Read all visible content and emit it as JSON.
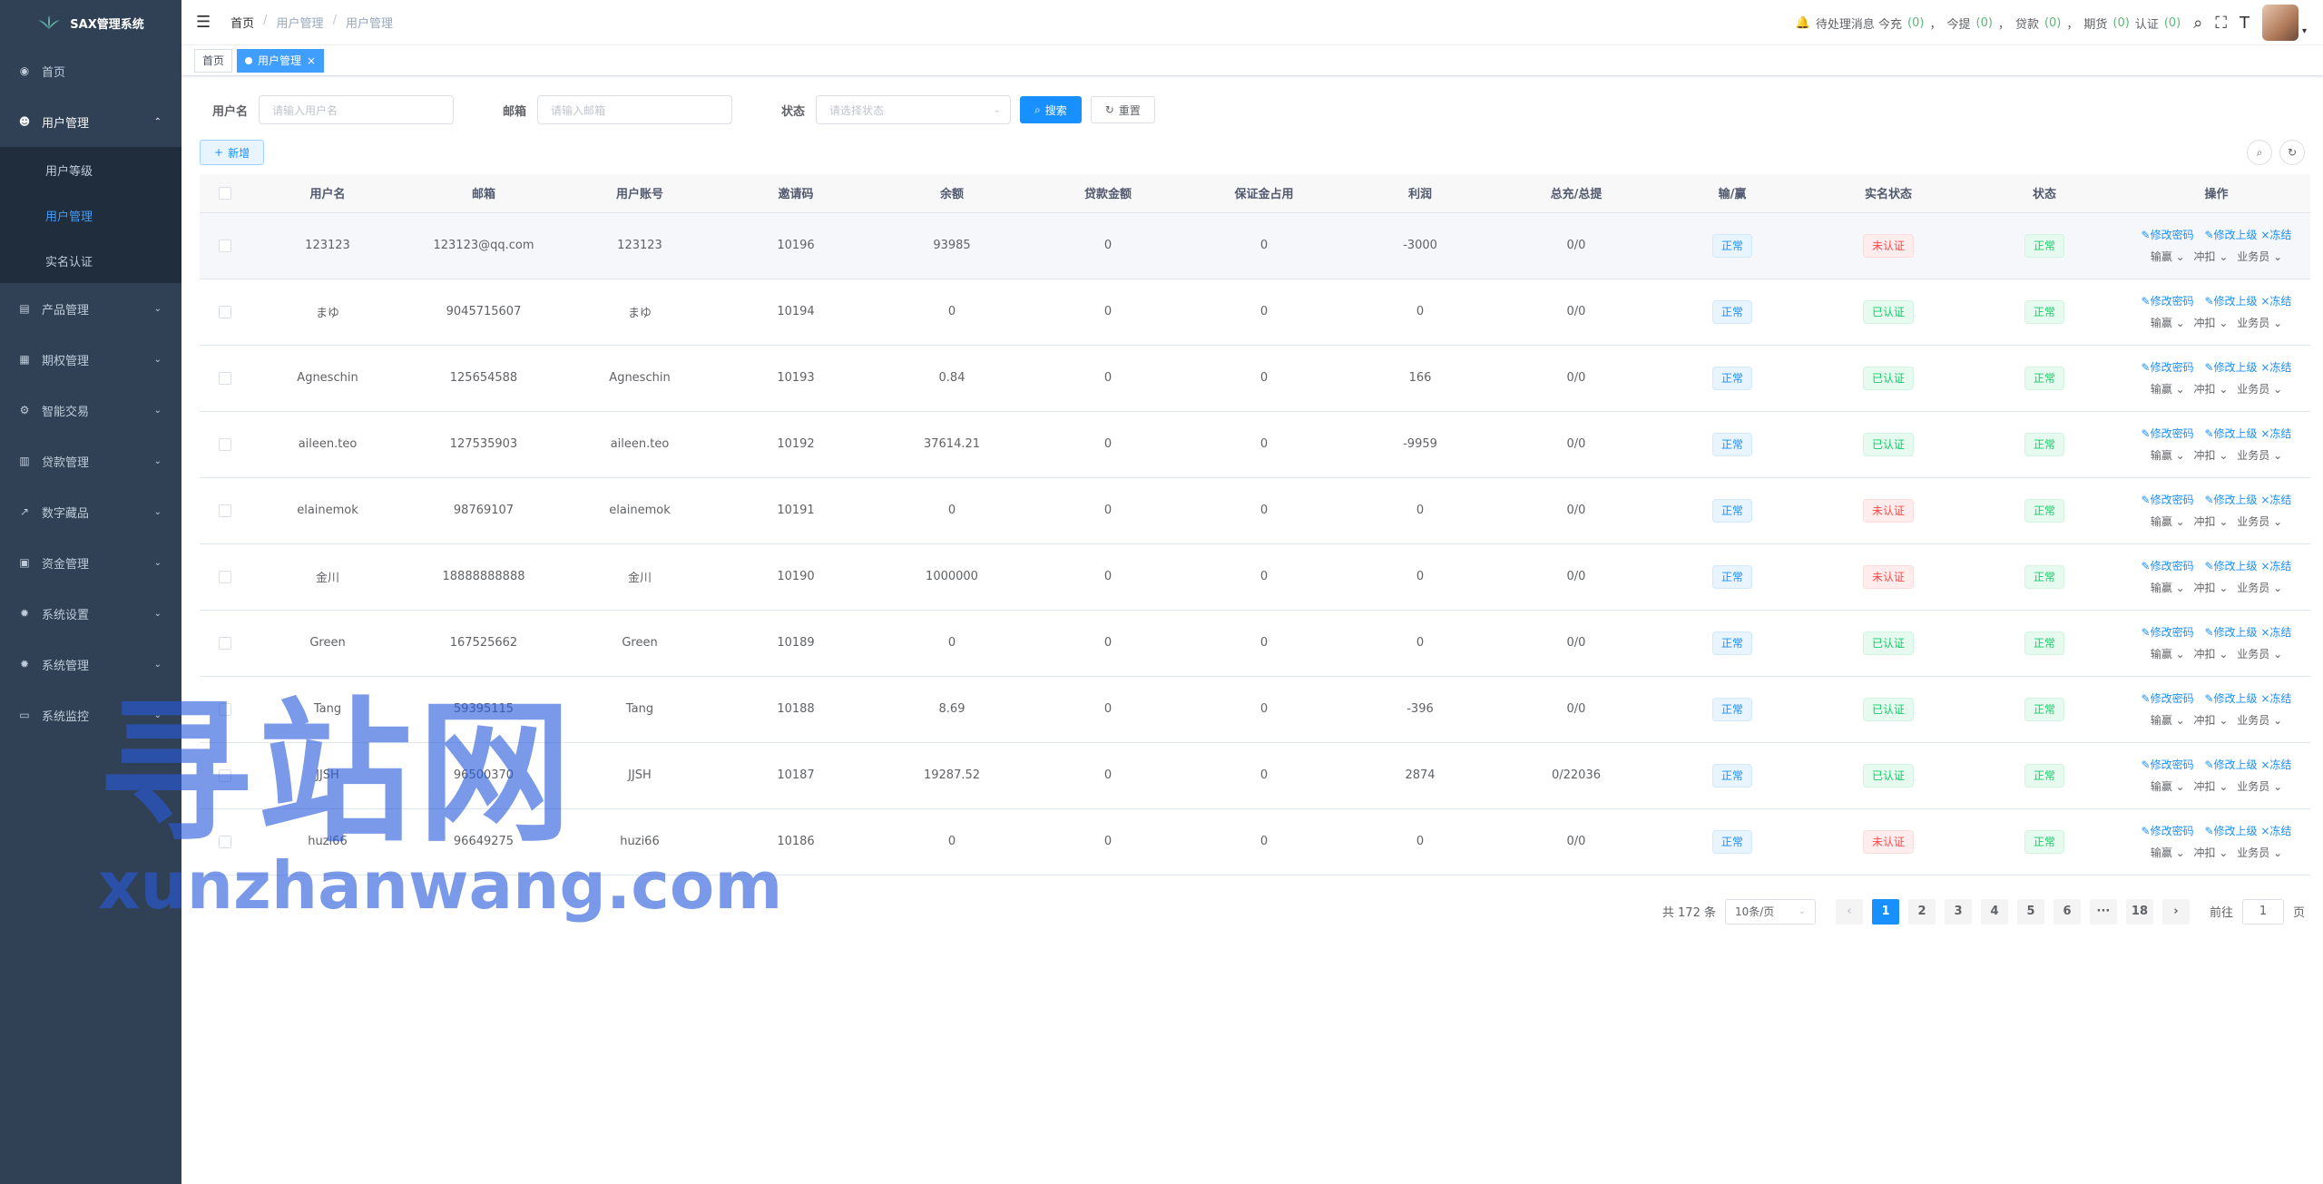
{
  "app": {
    "title": "SAX管理系统"
  },
  "sidebar": {
    "items": [
      {
        "label": "首页",
        "icon": "dashboard-icon",
        "has_arrow": false
      },
      {
        "label": "用户管理",
        "icon": "user-icon",
        "has_arrow": true,
        "open": true,
        "children": [
          {
            "label": "用户等级",
            "active": false
          },
          {
            "label": "用户管理",
            "active": true
          },
          {
            "label": "实名认证",
            "active": false
          }
        ]
      },
      {
        "label": "产品管理",
        "icon": "document-icon",
        "has_arrow": true
      },
      {
        "label": "期权管理",
        "icon": "chart-icon",
        "has_arrow": true
      },
      {
        "label": "智能交易",
        "icon": "gear-icon",
        "has_arrow": true
      },
      {
        "label": "贷款管理",
        "icon": "server-icon",
        "has_arrow": true
      },
      {
        "label": "数字藏品",
        "icon": "trend-icon",
        "has_arrow": true
      },
      {
        "label": "资金管理",
        "icon": "wallet-icon",
        "has_arrow": true
      },
      {
        "label": "系统设置",
        "icon": "settings-icon",
        "has_arrow": true
      },
      {
        "label": "系统管理",
        "icon": "settings-icon",
        "has_arrow": true
      },
      {
        "label": "系统监控",
        "icon": "monitor-icon",
        "has_arrow": true
      }
    ]
  },
  "navbar": {
    "breadcrumb": [
      "首页",
      "用户管理",
      "用户管理"
    ],
    "notice_prefix": "待处理消息 今充",
    "counters": [
      {
        "label": "",
        "value": "(0)"
      },
      {
        "label": "今提",
        "value": "(0)"
      },
      {
        "label": "贷款",
        "value": "(0)"
      },
      {
        "label": "期货",
        "value": "(0)"
      },
      {
        "label": "认证",
        "value": "(0)"
      }
    ]
  },
  "tags": {
    "home": "首页",
    "active": "用户管理",
    "close": "×"
  },
  "search": {
    "username_label": "用户名",
    "username_placeholder": "请输入用户名",
    "email_label": "邮箱",
    "email_placeholder": "请输入邮箱",
    "status_label": "状态",
    "status_placeholder": "请选择状态",
    "search_btn": "搜索",
    "reset_btn": "重置"
  },
  "toolbar": {
    "add_btn": "新增"
  },
  "table": {
    "headers": [
      "用户名",
      "邮箱",
      "用户账号",
      "邀请码",
      "余额",
      "贷款金额",
      "保证金占用",
      "利润",
      "总充/总提",
      "输/赢",
      "实名状态",
      "状态",
      "操作"
    ],
    "rows": [
      {
        "username": "123123",
        "email": "123123@qq.com",
        "account": "123123",
        "invite": "10196",
        "balance": "93985",
        "loan": "0",
        "margin": "0",
        "profit": "-3000",
        "charge": "0/0",
        "win": "正常",
        "verify": "未认证",
        "verified": false,
        "status": "正常"
      },
      {
        "username": "まゆ",
        "email": "9045715607",
        "account": "まゆ",
        "invite": "10194",
        "balance": "0",
        "loan": "0",
        "margin": "0",
        "profit": "0",
        "charge": "0/0",
        "win": "正常",
        "verify": "已认证",
        "verified": true,
        "status": "正常"
      },
      {
        "username": "Agneschin",
        "email": "125654588",
        "account": "Agneschin",
        "invite": "10193",
        "balance": "0.84",
        "loan": "0",
        "margin": "0",
        "profit": "166",
        "charge": "0/0",
        "win": "正常",
        "verify": "已认证",
        "verified": true,
        "status": "正常"
      },
      {
        "username": "aileen.teo",
        "email": "127535903",
        "account": "aileen.teo",
        "invite": "10192",
        "balance": "37614.21",
        "loan": "0",
        "margin": "0",
        "profit": "-9959",
        "charge": "0/0",
        "win": "正常",
        "verify": "已认证",
        "verified": true,
        "status": "正常"
      },
      {
        "username": "elainemok",
        "email": "98769107",
        "account": "elainemok",
        "invite": "10191",
        "balance": "0",
        "loan": "0",
        "margin": "0",
        "profit": "0",
        "charge": "0/0",
        "win": "正常",
        "verify": "未认证",
        "verified": false,
        "status": "正常"
      },
      {
        "username": "金川",
        "email": "18888888888",
        "account": "金川",
        "invite": "10190",
        "balance": "1000000",
        "loan": "0",
        "margin": "0",
        "profit": "0",
        "charge": "0/0",
        "win": "正常",
        "verify": "未认证",
        "verified": false,
        "status": "正常"
      },
      {
        "username": "Green",
        "email": "167525662",
        "account": "Green",
        "invite": "10189",
        "balance": "0",
        "loan": "0",
        "margin": "0",
        "profit": "0",
        "charge": "0/0",
        "win": "正常",
        "verify": "已认证",
        "verified": true,
        "status": "正常"
      },
      {
        "username": "Tang",
        "email": "59395115",
        "account": "Tang",
        "invite": "10188",
        "balance": "8.69",
        "loan": "0",
        "margin": "0",
        "profit": "-396",
        "charge": "0/0",
        "win": "正常",
        "verify": "已认证",
        "verified": true,
        "status": "正常"
      },
      {
        "username": "JJSH",
        "email": "96500370",
        "account": "JJSH",
        "invite": "10187",
        "balance": "19287.52",
        "loan": "0",
        "margin": "0",
        "profit": "2874",
        "charge": "0/22036",
        "win": "正常",
        "verify": "已认证",
        "verified": true,
        "status": "正常"
      },
      {
        "username": "huzi66",
        "email": "96649275",
        "account": "huzi66",
        "invite": "10186",
        "balance": "0",
        "loan": "0",
        "margin": "0",
        "profit": "0",
        "charge": "0/0",
        "win": "正常",
        "verify": "未认证",
        "verified": false,
        "status": "正常"
      }
    ],
    "ops": {
      "edit_pwd": "修改密码",
      "edit_parent": "修改上级",
      "freeze": "冻结",
      "win_lose": "输赢",
      "deduct": "冲扣",
      "agent": "业务员"
    }
  },
  "pagination": {
    "total": "共 172 条",
    "page_size": "10条/页",
    "pages": [
      "1",
      "2",
      "3",
      "4",
      "5",
      "6",
      "···",
      "18"
    ],
    "current": "1",
    "goto_prefix": "前往",
    "goto_value": "1",
    "goto_suffix": "页"
  },
  "watermark": {
    "big": "寻站网",
    "small": "xunzhanwang.com"
  },
  "colors": {
    "sidebar_bg": "#304156",
    "submenu_bg": "#1f2d3d",
    "primary": "#1890ff",
    "success": "#13ce66",
    "danger": "#ff4949"
  }
}
